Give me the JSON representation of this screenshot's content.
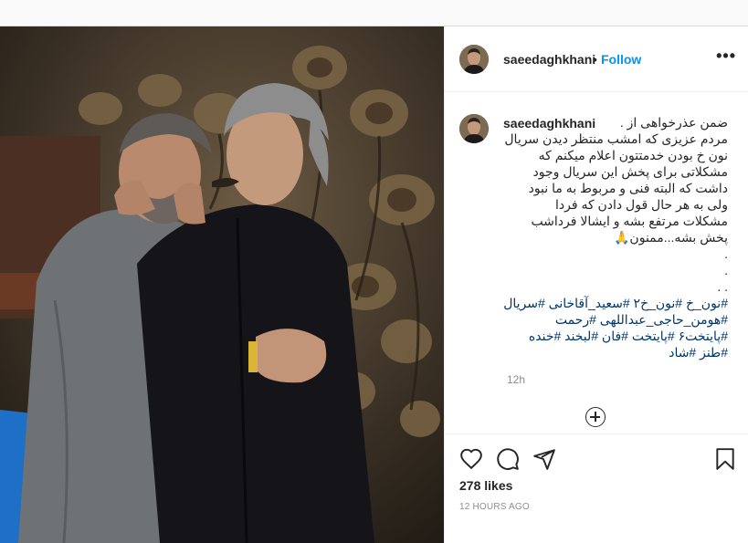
{
  "post": {
    "header": {
      "username": "saeedaghkhani",
      "separator": "•",
      "follow_label": "Follow",
      "more_icon": "more-horizontal-icon",
      "more_label": "•••"
    },
    "caption": {
      "username": "saeedaghkhani",
      "text": "ضمن عذرخواهی از .\nمردم عزیزی که امشب منتظر دیدن سریال\nنون خ بودن خدمتتون اعلام میکنم که\nمشکلاتی برای پخش این سریال وجود\nداشت که البته فنی و مربوط به ما نبود\nولی به هر حال قول دادن که فردا\nمشکلات مرتفع بشه و ایشالا فرداشب\nپخش بشه...ممنون🙏\n.\n.\n. .",
      "hashtags": "#نون_خ #نون_خ۲ #سعید_آقاخانی #سریال\n#هومن_حاجی_عبداللهی #رحمت\n#پایتخت۶ #پایتخت #فان #لبخند #خنده\n#طنز #شاد",
      "time": "12h"
    },
    "load_more_icon": "plus-circle-icon",
    "actions": {
      "like_icon": "heart-icon",
      "comment_icon": "comment-icon",
      "share_icon": "paper-plane-icon",
      "save_icon": "bookmark-icon"
    },
    "likes": "278 likes",
    "timestamp": "12 HOURS AGO"
  }
}
